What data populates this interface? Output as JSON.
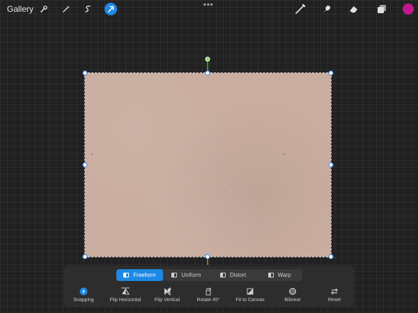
{
  "topbar": {
    "gallery_label": "Gallery",
    "left_tools": [
      "wrench-icon",
      "magic-wand-icon",
      "selection-s-icon",
      "transform-arrow-icon"
    ],
    "more_label": "•••",
    "right_tools": [
      "brush-icon",
      "smudge-icon",
      "eraser-icon",
      "layers-icon"
    ],
    "current_color": "#c2188f"
  },
  "modes": [
    {
      "label": "Freeform",
      "active": true
    },
    {
      "label": "Uniform",
      "active": false
    },
    {
      "label": "Distort",
      "active": false
    },
    {
      "label": "Warp",
      "active": false
    }
  ],
  "actions": [
    {
      "label": "Snapping",
      "icon": "snapping-icon"
    },
    {
      "label": "Flip Horizontal",
      "icon": "flip-horizontal-icon"
    },
    {
      "label": "Flip Vertical",
      "icon": "flip-vertical-icon"
    },
    {
      "label": "Rotate 45°",
      "icon": "rotate-icon"
    },
    {
      "label": "Fit to Canvas",
      "icon": "fit-to-canvas-icon"
    },
    {
      "label": "Bilinear",
      "icon": "bilinear-icon"
    },
    {
      "label": "Reset",
      "icon": "reset-icon"
    }
  ],
  "colors": {
    "accent": "#1e88e5",
    "rotation_handle": "#7ed957",
    "anchor_line": "#e0c23a",
    "canvas": "#c9ada0"
  }
}
